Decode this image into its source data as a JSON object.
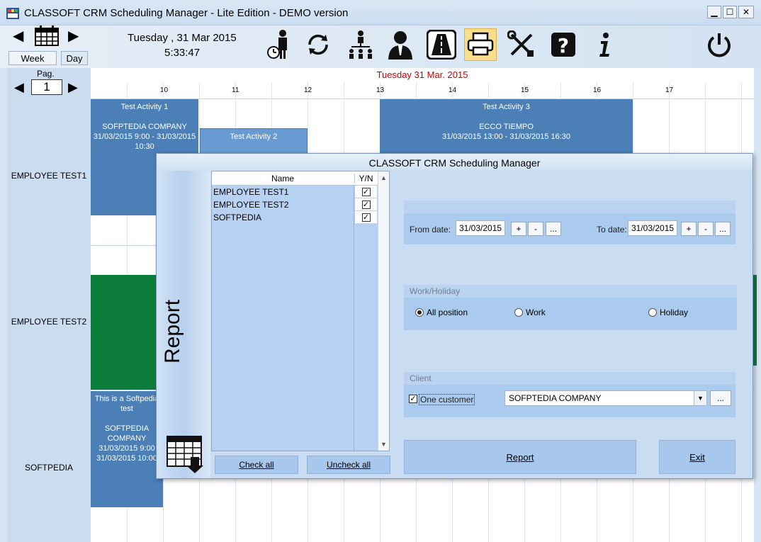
{
  "window": {
    "title": "CLASSOFT CRM Scheduling Manager  - Lite Edition  - DEMO version",
    "min_label": "▁",
    "max_label": "☐",
    "close_label": "✕"
  },
  "toolbar": {
    "date": "Tuesday ,  31 Mar 2015",
    "time": "5:33:47",
    "week_label": "Week",
    "day_label": "Day",
    "icons": [
      "employee-clock-icon",
      "refresh-icon",
      "org-chart-icon",
      "customer-icon",
      "road-icon",
      "printer-icon",
      "tools-icon",
      "help-icon",
      "info-icon",
      "power-icon"
    ]
  },
  "schedule": {
    "page_label": "Pag.",
    "page_number": "1",
    "date_header": "Tuesday 31 Mar. 2015",
    "hours": [
      "10",
      "11",
      "12",
      "13",
      "14",
      "15",
      "16",
      "17"
    ],
    "employees": [
      "EMPLOYEE TEST1",
      "EMPLOYEE TEST2",
      "SOFTPEDIA"
    ],
    "activities": [
      {
        "title": "Test Activity 1",
        "client": "SOFPTEDIA COMPANY",
        "time": "31/03/2015 9:00 - 31/03/2015 10:30"
      },
      {
        "title": "Test Activity 2"
      },
      {
        "title": "Test Activity 3",
        "client": "ECCO TIEMPO",
        "time": "31/03/2015 13:00 - 31/03/2015 16:30"
      },
      {
        "title": "This is a Softpedia test",
        "client": "SOFTPEDIA COMPANY",
        "time1": "31/03/2015 9:00",
        "time2": "31/03/2015 10:00"
      }
    ]
  },
  "dialog": {
    "title": "CLASSOFT CRM Scheduling Manager",
    "side_label": "Report",
    "list": {
      "col_name": "Name",
      "col_yn": "Y/N",
      "rows": [
        {
          "name": "EMPLOYEE TEST1",
          "checked": "✓"
        },
        {
          "name": "EMPLOYEE TEST2",
          "checked": "✓"
        },
        {
          "name": "SOFTPEDIA",
          "checked": "✓"
        }
      ]
    },
    "check_all": "Check all",
    "uncheck_all": "Uncheck all",
    "from_label": "From date:",
    "from_value": "31/03/2015",
    "to_label": "To date:",
    "to_value": "31/03/2015",
    "plus": "+",
    "minus": "-",
    "ellipsis": "...",
    "work_holiday_label": "Work/Holiday",
    "radio_all": "All position",
    "radio_work": "Work",
    "radio_holiday": "Holiday",
    "client_label": "Client",
    "one_customer": "One customer",
    "one_customer_checked": "✓",
    "customer_value": "SOFPTEDIA COMPANY",
    "report_btn": "Report",
    "exit_btn": "Exit"
  },
  "colors": {
    "activity_blue": "#4b7fb6",
    "activity_green": "#0d7d3c",
    "date_header": "#cc0000",
    "active_tool": "#f9dc8c"
  }
}
